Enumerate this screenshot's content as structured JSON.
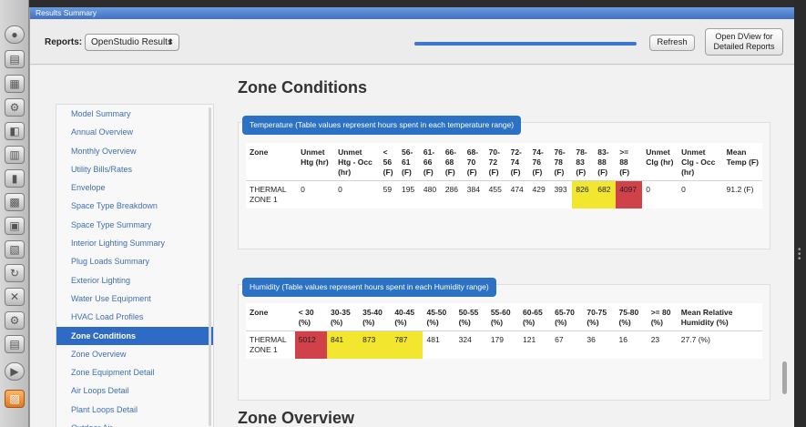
{
  "window": {
    "title": "Results Summary"
  },
  "tool_strip": {
    "icons": [
      "circle-icon",
      "book-icon",
      "grid-icon",
      "gear-icon",
      "layers-icon",
      "schedule-icon",
      "building-icon",
      "chart-icon",
      "space-icon",
      "thermal-icon",
      "loop-icon",
      "tools-icon",
      "settings-icon",
      "report-icon",
      "play-icon",
      "results-icon"
    ]
  },
  "toolbar": {
    "reports_label": "Reports:",
    "reports_value": "OpenStudio Results",
    "select_arrow": "⬍",
    "refresh_label": "Refresh",
    "dview_label": "Open DView for Detailed Reports",
    "progress": 1.0
  },
  "nav": {
    "items": [
      {
        "label": "Model Summary",
        "active": false
      },
      {
        "label": "Annual Overview",
        "active": false
      },
      {
        "label": "Monthly Overview",
        "active": false
      },
      {
        "label": "Utility Bills/Rates",
        "active": false
      },
      {
        "label": "Envelope",
        "active": false
      },
      {
        "label": "Space Type Breakdown",
        "active": false
      },
      {
        "label": "Space Type Summary",
        "active": false
      },
      {
        "label": "Interior Lighting Summary",
        "active": false
      },
      {
        "label": "Plug Loads Summary",
        "active": false
      },
      {
        "label": "Exterior Lighting",
        "active": false
      },
      {
        "label": "Water Use Equipment",
        "active": false
      },
      {
        "label": "HVAC Load Profiles",
        "active": false
      },
      {
        "label": "Zone Conditions",
        "active": true
      },
      {
        "label": "Zone Overview",
        "active": false
      },
      {
        "label": "Zone Equipment Detail",
        "active": false
      },
      {
        "label": "Air Loops Detail",
        "active": false
      },
      {
        "label": "Plant Loops Detail",
        "active": false
      },
      {
        "label": "Outdoor Air",
        "active": false
      }
    ]
  },
  "main": {
    "heading": "Zone Conditions",
    "next_heading": "Zone Overview",
    "temperature": {
      "title": "Temperature (Table values represent hours spent in each temperature range)",
      "headers": [
        "Zone",
        "Unmet Htg (hr)",
        "Unmet Htg - Occ (hr)",
        "< 56 (F)",
        "56-61 (F)",
        "61-66 (F)",
        "66-68 (F)",
        "68-70 (F)",
        "70-72 (F)",
        "72-74 (F)",
        "74-76 (F)",
        "76-78 (F)",
        "78-83 (F)",
        "83-88 (F)",
        ">= 88 (F)",
        "Unmet Clg (hr)",
        "Unmet Clg - Occ (hr)",
        "Mean Temp (F)"
      ],
      "rows": [
        {
          "cells": [
            "THERMAL ZONE 1",
            "0",
            "0",
            "59",
            "195",
            "480",
            "286",
            "384",
            "455",
            "474",
            "429",
            "393",
            "826",
            "682",
            "4097",
            "0",
            "0",
            "91.2 (F)"
          ],
          "highlight": [
            "",
            "",
            "",
            "",
            "",
            "",
            "",
            "",
            "",
            "",
            "",
            "",
            "yellow",
            "yellow",
            "red",
            "",
            "",
            ""
          ]
        }
      ]
    },
    "humidity": {
      "title": "Humidity (Table values represent hours spent in each Humidity range)",
      "headers": [
        "Zone",
        "< 30 (%)",
        "30-35 (%)",
        "35-40 (%)",
        "40-45 (%)",
        "45-50 (%)",
        "50-55 (%)",
        "55-60 (%)",
        "60-65 (%)",
        "65-70 (%)",
        "70-75 (%)",
        "75-80 (%)",
        ">= 80 (%)",
        "Mean Relative Humidity (%)"
      ],
      "rows": [
        {
          "cells": [
            "THERMAL ZONE 1",
            "5012",
            "841",
            "873",
            "787",
            "481",
            "324",
            "179",
            "121",
            "67",
            "36",
            "16",
            "23",
            "27.7 (%)"
          ],
          "highlight": [
            "",
            "red",
            "yellow",
            "yellow",
            "yellow",
            "",
            "",
            "",
            "",
            "",
            "",
            "",
            "",
            ""
          ]
        }
      ]
    }
  },
  "colors": {
    "accent": "#2e6bc4",
    "title_bar": "#3f70c2",
    "warn_yellow": "#f2e72e",
    "alert_red": "#d0414a"
  }
}
